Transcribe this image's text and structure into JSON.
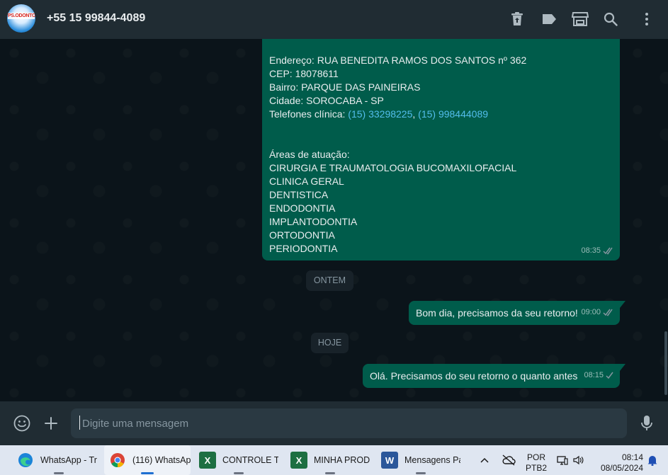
{
  "header": {
    "avatar_logo_text": "PS.ODONTO",
    "contact_name": "+55 15 99844-4089"
  },
  "messages": {
    "clinic_info": {
      "lines": [
        "Endereço: RUA BENEDITA RAMOS DOS SANTOS nº 362",
        "CEP: 18078611",
        "Bairro: PARQUE DAS PAINEIRAS",
        "Cidade: SOROCABA - SP"
      ],
      "phones_label": "Telefones clínica: ",
      "phone_1": "(15) 33298225",
      "phone_sep": ", ",
      "phone_2": "(15) 998444089",
      "areas_title": "Áreas de atuação:",
      "areas": [
        "CIRURGIA E TRAUMATOLOGIA BUCOMAXILOFACIAL",
        "CLINICA GERAL",
        "DENTISTICA",
        "ENDODONTIA",
        "IMPLANTODONTIA",
        "ORTODONTIA",
        "PERIODONTIA"
      ],
      "time": "08:35",
      "status": "read"
    },
    "date_yesterday": "ONTEM",
    "msg_yesterday": {
      "text": "Bom dia, precisamos da seu retorno!",
      "time": "09:00",
      "status": "read"
    },
    "date_today": "HOJE",
    "msg_today": {
      "text": "Olá. Precisamos do seu retorno o quanto antes",
      "time": "08:15",
      "status": "sent"
    }
  },
  "composer": {
    "placeholder": "Digite uma mensagem"
  },
  "taskbar": {
    "items": [
      {
        "label": "WhatsApp - Tr",
        "icon": "edge-icon"
      },
      {
        "label": "(116) WhatsAp",
        "icon": "chrome-icon"
      },
      {
        "label": "CONTROLE TE",
        "icon": "excel-icon"
      },
      {
        "label": "MINHA PRODI",
        "icon": "excel-icon"
      },
      {
        "label": "Mensagens Pa",
        "icon": "word-icon"
      }
    ],
    "language": "POR",
    "keyboard": "PTB2",
    "time": "08:14",
    "date": "08/05/2024"
  },
  "colors": {
    "header_bg": "#202c33",
    "chat_bg": "#0b141a",
    "outgoing_bubble": "#005c4b",
    "link": "#53bdeb",
    "read_ticks": "#53bdeb",
    "taskbar_bg": "#dfe6f1"
  }
}
